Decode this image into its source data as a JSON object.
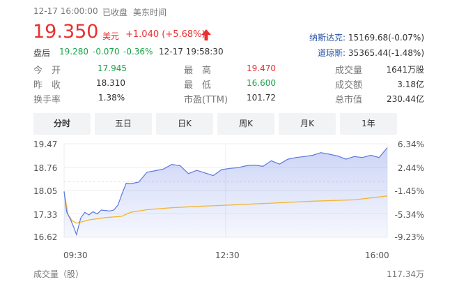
{
  "header": {
    "datetime": "12-17 16:00:00",
    "status": "已收盘",
    "timezone": "美东时间"
  },
  "price": {
    "last": "19.350",
    "currency": "美元",
    "change": "+1.040 (+5.68%)",
    "direction_icon": "up-arrow-icon"
  },
  "after_hours": {
    "label": "盘后",
    "price": "19.280",
    "change": "-0.070",
    "percent": "-0.36%",
    "time": "12-17 19:58:30"
  },
  "indices": [
    {
      "name": "纳斯达克:",
      "value": "15169.68(-0.07%)"
    },
    {
      "name": "道琼斯:",
      "value": "35365.44(-1.48%)"
    }
  ],
  "stats": {
    "open_label": "今　开",
    "open": "17.945",
    "prev_close_label": "昨　收",
    "prev_close": "18.310",
    "turnover_label": "换手率",
    "turnover": "1.38%",
    "high_label": "最　高",
    "high": "19.470",
    "low_label": "最　低",
    "low": "16.600",
    "pe_label": "市盈(TTM)",
    "pe": "101.72",
    "volume_label": "成交量",
    "volume": "1641万股",
    "amount_label": "成交额",
    "amount": "3.18亿",
    "mktcap_label": "总市值",
    "mktcap": "230.44亿"
  },
  "tabs": [
    "分时",
    "五日",
    "日K",
    "周K",
    "月K",
    "1年"
  ],
  "active_tab": "分时",
  "colors": {
    "up": "#e93030",
    "down": "#1aa34a",
    "price_line": "#5b78e0",
    "avg_line": "#f2b632",
    "grid": "#e8e8e8"
  },
  "chart_data": {
    "type": "line",
    "y_ticks": [
      "19.47",
      "18.76",
      "18.05",
      "17.33",
      "16.62"
    ],
    "y_pct_ticks": [
      "6.34%",
      "2.44%",
      "-1.45%",
      "-5.34%",
      "-9.23%"
    ],
    "x_ticks": [
      "09:30",
      "12:30",
      "16:00"
    ],
    "ylim": [
      16.62,
      19.47
    ],
    "baseline": 18.31,
    "volume_label": "成交量（股）",
    "volume_max": "117.34万",
    "series": [
      {
        "key": "price",
        "x": [
          0,
          3,
          8,
          12,
          15,
          20,
          25,
          30,
          35,
          40,
          45,
          55,
          60,
          65,
          70,
          75,
          80,
          90,
          100,
          110,
          120,
          130,
          140,
          150,
          160,
          170,
          180,
          190,
          200,
          210,
          220,
          230,
          240,
          250,
          260,
          270,
          280,
          290,
          300,
          310,
          320,
          330,
          340,
          350,
          360,
          370,
          380,
          390
        ],
        "y": [
          18.02,
          17.4,
          17.15,
          16.9,
          16.7,
          17.2,
          17.38,
          17.3,
          17.4,
          17.33,
          17.45,
          17.42,
          17.45,
          17.6,
          17.95,
          18.27,
          18.25,
          18.3,
          18.6,
          18.65,
          18.7,
          18.84,
          18.8,
          18.56,
          18.66,
          18.58,
          18.5,
          18.68,
          18.72,
          18.74,
          18.8,
          18.82,
          18.78,
          18.95,
          18.85,
          19.0,
          19.05,
          19.08,
          19.12,
          19.2,
          19.15,
          19.1,
          19.0,
          19.08,
          19.05,
          19.12,
          19.05,
          19.35
        ]
      },
      {
        "key": "average",
        "x": [
          0,
          5,
          10,
          15,
          20,
          30,
          50,
          70,
          80,
          100,
          130,
          160,
          200,
          250,
          300,
          350,
          390
        ],
        "y": [
          18.0,
          17.3,
          17.12,
          17.05,
          17.08,
          17.15,
          17.22,
          17.26,
          17.38,
          17.46,
          17.52,
          17.56,
          17.6,
          17.66,
          17.72,
          17.76,
          17.88
        ]
      }
    ]
  }
}
